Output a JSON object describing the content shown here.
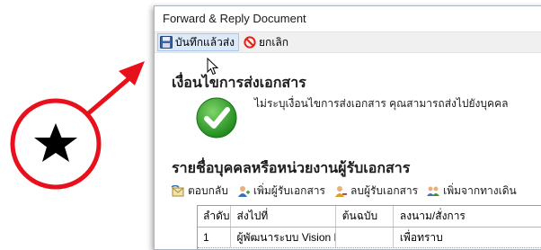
{
  "window": {
    "title": "Forward & Reply Document"
  },
  "toolbar": {
    "save_label": "บันทึกแล้วส่ง",
    "cancel_label": "ยกเลิก"
  },
  "condition_section": {
    "heading": "เงื่อนไขการส่งเอกสาร",
    "note": "ไม่ระบุเงื่อนไขการส่งเอกสาร คุณสามารถส่งไปยังบุคคล"
  },
  "recipients_section": {
    "heading": "รายชื่อบุคคลหรือหน่วยงานผู้รับเอกสาร",
    "actions": [
      {
        "label": "ตอบกลับ",
        "icon": "reply-icon"
      },
      {
        "label": "เพิ่มผู้รับเอกสาร",
        "icon": "add-user-icon"
      },
      {
        "label": "ลบผู้รับเอกสาร",
        "icon": "remove-user-icon"
      },
      {
        "label": "เพิ่มจากทางเดิน",
        "icon": "add-from-path-icon"
      }
    ],
    "table": {
      "columns": [
        "ลำดับ",
        "ส่งไปที่",
        "ต้นฉบับ",
        "ลงนาม/สั่งการ"
      ],
      "rows": [
        {
          "order": "1",
          "send_to": "ผู้พัฒนาระบบ Vision Net",
          "original": "",
          "action": "เพื่อทราบ"
        }
      ]
    }
  },
  "annotation": {
    "icon": "star-icon",
    "circle_color": "#e8101a",
    "arrow_color": "#e8101a"
  }
}
